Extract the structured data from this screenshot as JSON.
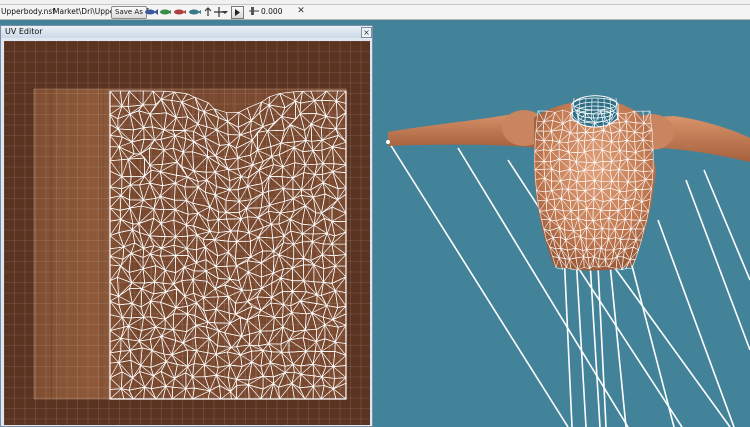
{
  "toolbar": {
    "file_path": "Upperbody.nsf",
    "full_path": "Market\\Dri\\Upperbody.nsf",
    "save_as_label": "Save As",
    "time_value": "0.000"
  },
  "uv_editor": {
    "title": "UV Editor"
  },
  "colors": {
    "viewport_bg": "#43839a",
    "wireframe": "#ffffff",
    "skin": "#c8805a",
    "uv_texture": "#7a4a30"
  }
}
